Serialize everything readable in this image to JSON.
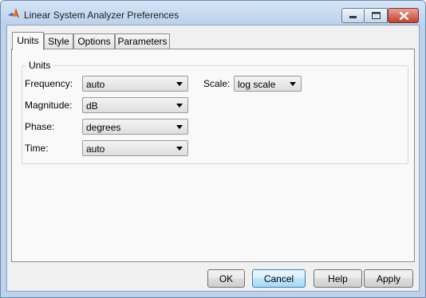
{
  "window": {
    "title": "Linear System Analyzer Preferences",
    "icon": "matlab-logo-icon",
    "controls": [
      "minimize-icon",
      "maximize-icon",
      "close-icon"
    ]
  },
  "tabs": [
    {
      "label": "Units",
      "active": true
    },
    {
      "label": "Style",
      "active": false
    },
    {
      "label": "Options",
      "active": false
    },
    {
      "label": "Parameters",
      "active": false
    }
  ],
  "units_group": {
    "title": "Units",
    "frequency": {
      "label": "Frequency:",
      "value": "auto"
    },
    "scale": {
      "label": "Scale:",
      "value": "log scale"
    },
    "magnitude": {
      "label": "Magnitude:",
      "value": "dB"
    },
    "phase": {
      "label": "Phase:",
      "value": "degrees"
    },
    "time": {
      "label": "Time:",
      "value": "auto"
    }
  },
  "buttons": {
    "ok": "OK",
    "cancel": "Cancel",
    "help": "Help",
    "apply": "Apply"
  },
  "colors": {
    "frame": "#bcd2ec",
    "default_button_border": "#3c7fb1",
    "close_button": "#c5412c"
  }
}
